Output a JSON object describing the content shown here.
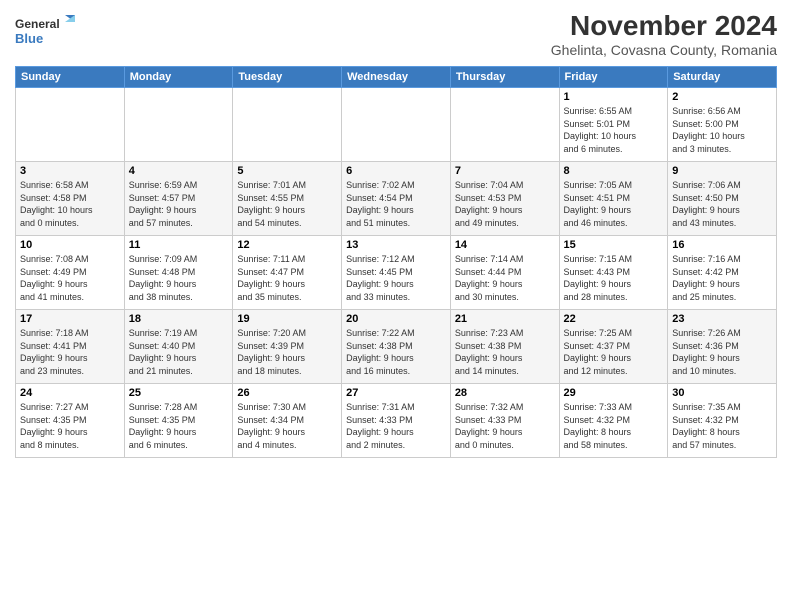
{
  "logo": {
    "line1": "General",
    "line2": "Blue"
  },
  "title": "November 2024",
  "subtitle": "Ghelinta, Covasna County, Romania",
  "weekdays": [
    "Sunday",
    "Monday",
    "Tuesday",
    "Wednesday",
    "Thursday",
    "Friday",
    "Saturday"
  ],
  "weeks": [
    [
      {
        "day": "",
        "info": ""
      },
      {
        "day": "",
        "info": ""
      },
      {
        "day": "",
        "info": ""
      },
      {
        "day": "",
        "info": ""
      },
      {
        "day": "",
        "info": ""
      },
      {
        "day": "1",
        "info": "Sunrise: 6:55 AM\nSunset: 5:01 PM\nDaylight: 10 hours\nand 6 minutes."
      },
      {
        "day": "2",
        "info": "Sunrise: 6:56 AM\nSunset: 5:00 PM\nDaylight: 10 hours\nand 3 minutes."
      }
    ],
    [
      {
        "day": "3",
        "info": "Sunrise: 6:58 AM\nSunset: 4:58 PM\nDaylight: 10 hours\nand 0 minutes."
      },
      {
        "day": "4",
        "info": "Sunrise: 6:59 AM\nSunset: 4:57 PM\nDaylight: 9 hours\nand 57 minutes."
      },
      {
        "day": "5",
        "info": "Sunrise: 7:01 AM\nSunset: 4:55 PM\nDaylight: 9 hours\nand 54 minutes."
      },
      {
        "day": "6",
        "info": "Sunrise: 7:02 AM\nSunset: 4:54 PM\nDaylight: 9 hours\nand 51 minutes."
      },
      {
        "day": "7",
        "info": "Sunrise: 7:04 AM\nSunset: 4:53 PM\nDaylight: 9 hours\nand 49 minutes."
      },
      {
        "day": "8",
        "info": "Sunrise: 7:05 AM\nSunset: 4:51 PM\nDaylight: 9 hours\nand 46 minutes."
      },
      {
        "day": "9",
        "info": "Sunrise: 7:06 AM\nSunset: 4:50 PM\nDaylight: 9 hours\nand 43 minutes."
      }
    ],
    [
      {
        "day": "10",
        "info": "Sunrise: 7:08 AM\nSunset: 4:49 PM\nDaylight: 9 hours\nand 41 minutes."
      },
      {
        "day": "11",
        "info": "Sunrise: 7:09 AM\nSunset: 4:48 PM\nDaylight: 9 hours\nand 38 minutes."
      },
      {
        "day": "12",
        "info": "Sunrise: 7:11 AM\nSunset: 4:47 PM\nDaylight: 9 hours\nand 35 minutes."
      },
      {
        "day": "13",
        "info": "Sunrise: 7:12 AM\nSunset: 4:45 PM\nDaylight: 9 hours\nand 33 minutes."
      },
      {
        "day": "14",
        "info": "Sunrise: 7:14 AM\nSunset: 4:44 PM\nDaylight: 9 hours\nand 30 minutes."
      },
      {
        "day": "15",
        "info": "Sunrise: 7:15 AM\nSunset: 4:43 PM\nDaylight: 9 hours\nand 28 minutes."
      },
      {
        "day": "16",
        "info": "Sunrise: 7:16 AM\nSunset: 4:42 PM\nDaylight: 9 hours\nand 25 minutes."
      }
    ],
    [
      {
        "day": "17",
        "info": "Sunrise: 7:18 AM\nSunset: 4:41 PM\nDaylight: 9 hours\nand 23 minutes."
      },
      {
        "day": "18",
        "info": "Sunrise: 7:19 AM\nSunset: 4:40 PM\nDaylight: 9 hours\nand 21 minutes."
      },
      {
        "day": "19",
        "info": "Sunrise: 7:20 AM\nSunset: 4:39 PM\nDaylight: 9 hours\nand 18 minutes."
      },
      {
        "day": "20",
        "info": "Sunrise: 7:22 AM\nSunset: 4:38 PM\nDaylight: 9 hours\nand 16 minutes."
      },
      {
        "day": "21",
        "info": "Sunrise: 7:23 AM\nSunset: 4:38 PM\nDaylight: 9 hours\nand 14 minutes."
      },
      {
        "day": "22",
        "info": "Sunrise: 7:25 AM\nSunset: 4:37 PM\nDaylight: 9 hours\nand 12 minutes."
      },
      {
        "day": "23",
        "info": "Sunrise: 7:26 AM\nSunset: 4:36 PM\nDaylight: 9 hours\nand 10 minutes."
      }
    ],
    [
      {
        "day": "24",
        "info": "Sunrise: 7:27 AM\nSunset: 4:35 PM\nDaylight: 9 hours\nand 8 minutes."
      },
      {
        "day": "25",
        "info": "Sunrise: 7:28 AM\nSunset: 4:35 PM\nDaylight: 9 hours\nand 6 minutes."
      },
      {
        "day": "26",
        "info": "Sunrise: 7:30 AM\nSunset: 4:34 PM\nDaylight: 9 hours\nand 4 minutes."
      },
      {
        "day": "27",
        "info": "Sunrise: 7:31 AM\nSunset: 4:33 PM\nDaylight: 9 hours\nand 2 minutes."
      },
      {
        "day": "28",
        "info": "Sunrise: 7:32 AM\nSunset: 4:33 PM\nDaylight: 9 hours\nand 0 minutes."
      },
      {
        "day": "29",
        "info": "Sunrise: 7:33 AM\nSunset: 4:32 PM\nDaylight: 8 hours\nand 58 minutes."
      },
      {
        "day": "30",
        "info": "Sunrise: 7:35 AM\nSunset: 4:32 PM\nDaylight: 8 hours\nand 57 minutes."
      }
    ]
  ]
}
